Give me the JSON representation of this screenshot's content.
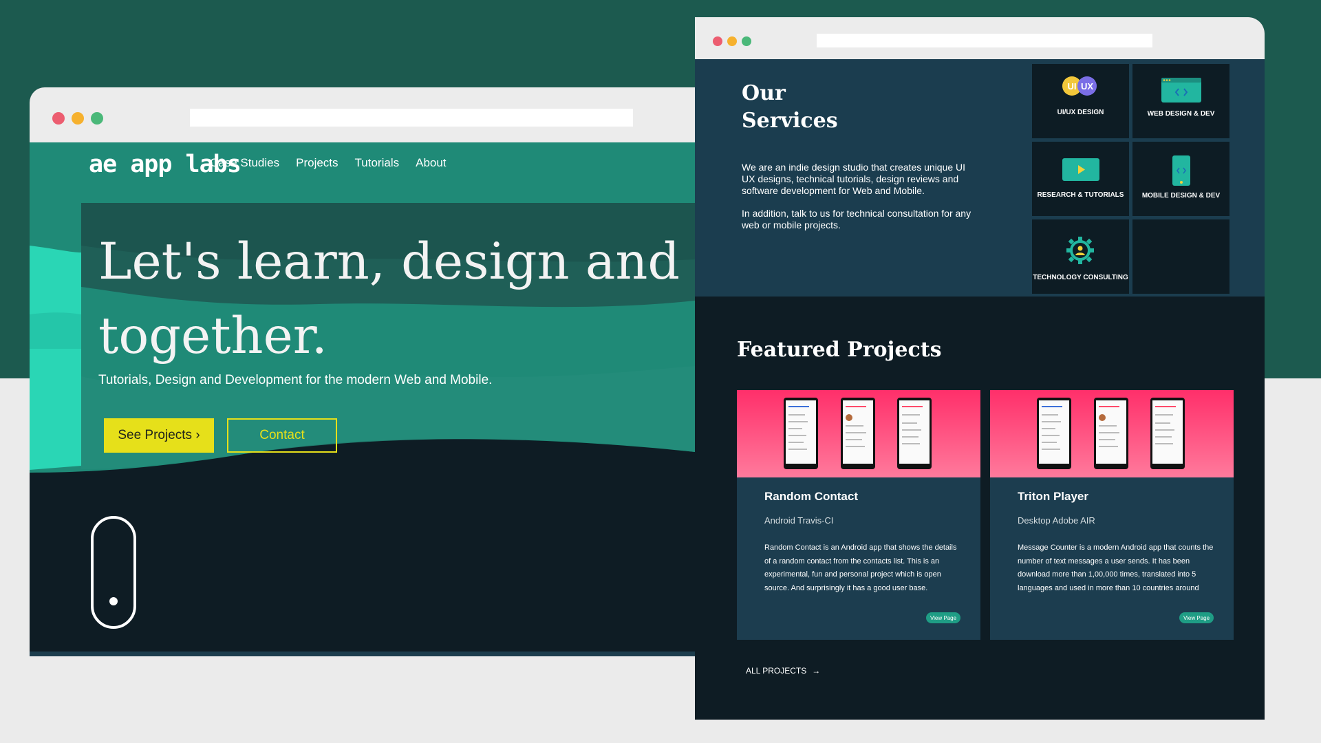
{
  "colors": {
    "background_top": "#1c5a4f",
    "background_bottom": "#ebebeb",
    "navbar": "#1f8a77",
    "accent_yellow": "#e6e01a",
    "services_bg": "#1b3d4f",
    "dark_bg": "#0e1c24",
    "card_gradient_top": "#ff2f6a",
    "teal_button": "#1f9d85"
  },
  "left_window": {
    "logo": "ae app labs",
    "nav": [
      "Case Studies",
      "Projects",
      "Tutorials",
      "About"
    ],
    "hero_line1": "Let's learn, design and buil",
    "hero_line2": "together.",
    "subtitle": "Tutorials, Design and Development for the modern Web and Mobile.",
    "btn_primary": "See Projects ›",
    "btn_secondary": "Contact"
  },
  "right_window": {
    "services_title": "Our Services",
    "services_p1": "We are an indie design studio that creates unique UI UX designs, technical tutorials, design reviews and software development for Web and Mobile.",
    "services_p2": "In addition, talk to us for technical consultation for any web or mobile projects.",
    "service_tiles": [
      {
        "label": "UI/UX DESIGN",
        "icon": "ui-ux-badge-icon",
        "badge_ui": "UI",
        "badge_ux": "UX"
      },
      {
        "label": "WEB DESIGN & DEV",
        "icon": "browser-code-icon"
      },
      {
        "label": "RESEARCH & TUTORIALS",
        "icon": "play-video-icon"
      },
      {
        "label": "MOBILE DESIGN & DEV",
        "icon": "mobile-phone-icon"
      },
      {
        "label": "TECHNOLOGY CONSULTING",
        "icon": "gear-person-icon"
      },
      {
        "label": "",
        "icon": ""
      }
    ],
    "featured_title": "Featured Projects",
    "projects": [
      {
        "name": "Random Contact",
        "tags": "Android Travis-CI",
        "description": "Random Contact is an Android app that shows the details of a random contact from the contacts list. This is an experimental, fun and personal project which is open source. And surprisingly it has a good user base.",
        "button": "View Page"
      },
      {
        "name": "Triton Player",
        "tags": "Desktop Adobe AIR",
        "description": "Message Counter is a modern Android app that counts the number of text messages a user sends. It has been download more than 1,00,000 times, translated into 5 languages and used in more than 10 countries around",
        "button": "View Page"
      }
    ],
    "all_projects": "ALL PROJECTS"
  }
}
